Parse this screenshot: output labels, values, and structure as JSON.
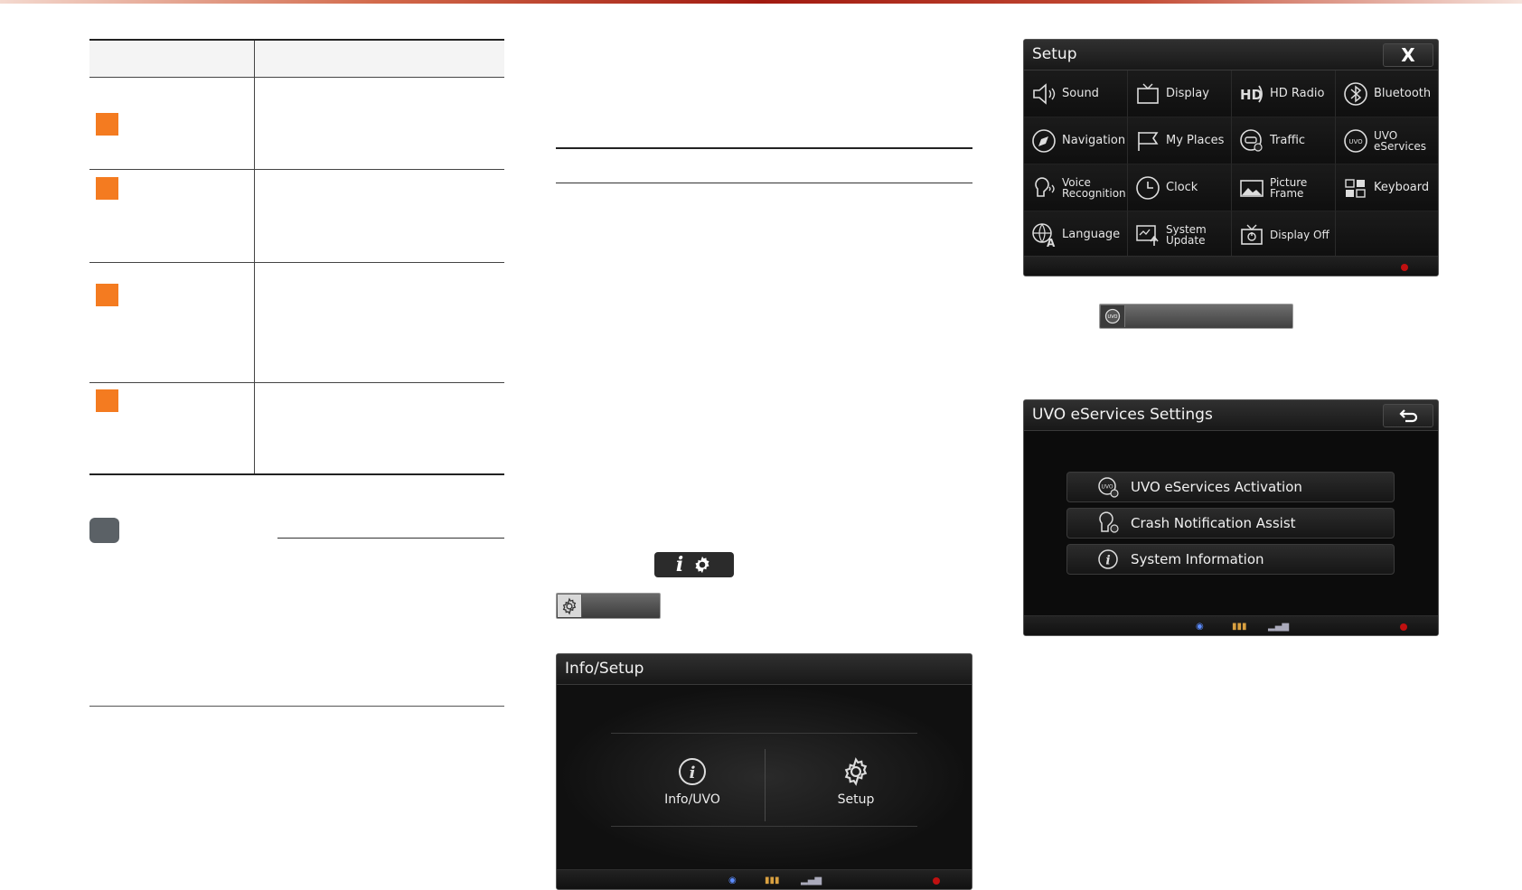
{
  "setup_screen": {
    "title": "Setup",
    "close_label": "X",
    "items": [
      {
        "label": "Sound",
        "icon": "speaker-icon"
      },
      {
        "label": "Display",
        "icon": "display-icon"
      },
      {
        "label": "HD Radio",
        "icon": "hd-radio-icon"
      },
      {
        "label": "Bluetooth",
        "icon": "bluetooth-icon"
      },
      {
        "label": "Navigation",
        "icon": "compass-icon"
      },
      {
        "label": "My Places",
        "icon": "flag-icon"
      },
      {
        "label": "Traffic",
        "icon": "traffic-icon"
      },
      {
        "label": "UVO eServices",
        "icon": "uvo-icon"
      },
      {
        "label": "Voice Recognition",
        "icon": "voice-icon"
      },
      {
        "label": "Clock",
        "icon": "clock-icon"
      },
      {
        "label": "Picture Frame",
        "icon": "picture-icon"
      },
      {
        "label": "Keyboard",
        "icon": "keyboard-icon"
      },
      {
        "label": "Language",
        "icon": "globe-icon"
      },
      {
        "label": "System Update",
        "icon": "system-update-icon"
      },
      {
        "label": "Display Off",
        "icon": "display-off-icon"
      }
    ]
  },
  "uvo_settings_screen": {
    "title": "UVO eServices Settings",
    "items": [
      {
        "label": "UVO eServices Activation",
        "icon": "uvo-activation-icon"
      },
      {
        "label": "Crash Notification Assist",
        "icon": "crash-assist-icon"
      },
      {
        "label": "System Information",
        "icon": "info-icon"
      }
    ]
  },
  "info_setup_screen": {
    "title": "Info/Setup",
    "options": [
      {
        "label": "Info/UVO",
        "icon": "info-icon"
      },
      {
        "label": "Setup",
        "icon": "gear-icon"
      }
    ]
  },
  "colors": {
    "accent_orange": "#f47b20",
    "screen_bg": "#0c0c0c",
    "note_badge": "#5b6166"
  }
}
